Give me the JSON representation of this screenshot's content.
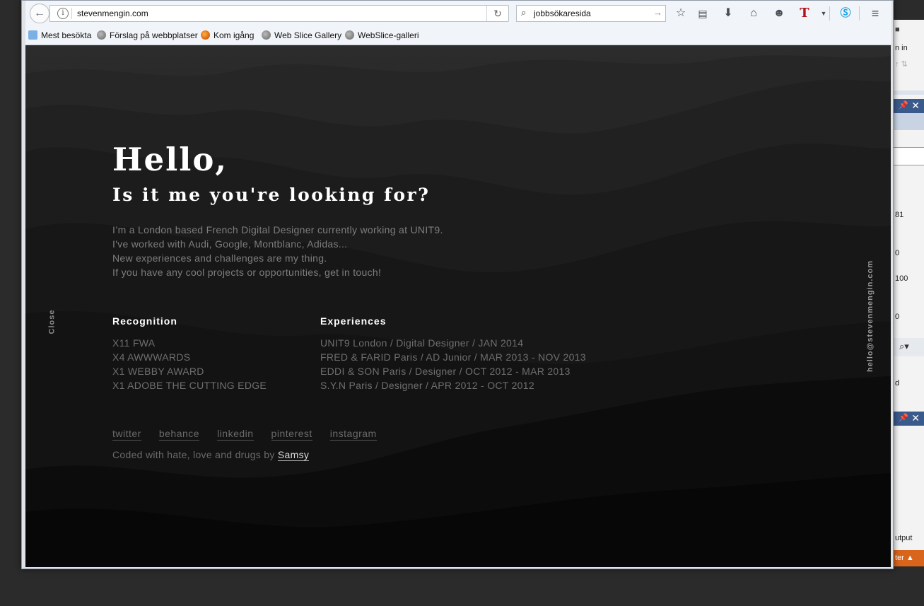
{
  "background_app": {
    "label_in": "n in",
    "num_81": "81",
    "num_0a": "0",
    "num_100": "100",
    "num_0b": "0",
    "label_d": "d",
    "label_output": "utput",
    "label_ter": "ter ▲"
  },
  "browser": {
    "url": "stevenmengin.com",
    "search_text": "jobbsökaresida",
    "bookmarks": [
      "Mest besökta",
      "Förslag på webbplatser",
      "Kom igång",
      "Web Slice Gallery",
      "WebSlice-galleri"
    ],
    "toolbar_icons": [
      "star-icon",
      "reading-list-icon",
      "download-icon",
      "home-icon",
      "chat-icon",
      "t-extension-icon",
      "dropdown-icon",
      "skype-icon",
      "menu-icon"
    ]
  },
  "page": {
    "hello": "Hello,",
    "tagline": "Is it me you're looking for?",
    "intro": [
      "I’m a London based French Digital Designer currently working at UNIT9.",
      "I've worked with Audi, Google, Montblanc, Adidas...",
      "New experiences and challenges are my thing.",
      "If you have any cool projects or opportunities, get in touch!"
    ],
    "recognition_title": "Recognition",
    "recognition": [
      "X11 FWA",
      "X4 AWWWARDS",
      "X1 WEBBY AWARD",
      "X1 ADOBE THE CUTTING EDGE"
    ],
    "experiences_title": "Experiences",
    "experiences": [
      "UNIT9 London / Digital Designer / JAN 2014",
      "FRED & FARID Paris / AD Junior / MAR 2013 - NOV 2013",
      "EDDI & SON Paris / Designer / OCT 2012 - MAR 2013",
      "S.Y.N Paris / Designer / APR 2012 - OCT 2012"
    ],
    "social": [
      "twitter",
      "behance",
      "linkedin",
      "pinterest",
      "instagram"
    ],
    "credits_prefix": "Coded with hate, love and drugs by",
    "credits_author": "Samsy",
    "close": "Close",
    "email": "hello@stevenmengin.com"
  }
}
